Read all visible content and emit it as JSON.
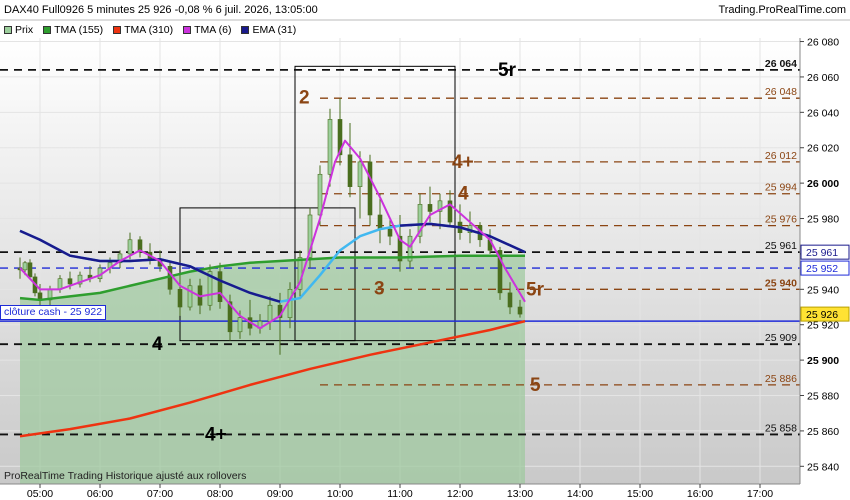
{
  "header": {
    "title": "DAX40 Full0926 5 minutes 25 926 -0,08 % 6 juil. 2026, 13:05:00",
    "site": "Trading.ProRealTime.com"
  },
  "legend": [
    {
      "label": "Prix",
      "color": "#9ccf9c"
    },
    {
      "label": "TMA (155)",
      "color": "#2e9e2e"
    },
    {
      "label": "TMA (310)",
      "color": "#ee3311"
    },
    {
      "label": "TMA (6)",
      "color": "#cc33dd"
    },
    {
      "label": "EMA (31)",
      "color": "#1a1a8c"
    }
  ],
  "cash_label": "clôture cash -  25 922",
  "caption": "ProRealTime Trading  Historique ajusté aux rollovers",
  "colors": {
    "grid": "#e4e4e4",
    "level_black": "#111111",
    "level_brown": "#8b4513",
    "cash_line": "#1f2bd8",
    "candles": "#4a6e1f",
    "area_fill": "#9cc99c",
    "tma6": "#cc33dd",
    "ema31": "#1a1a8c",
    "ema31_light": "#41b8f0",
    "tma155": "#2e9e2e",
    "tma310": "#ee3311",
    "last_price_bg": "#ffe233"
  },
  "chart_data": {
    "type": "line",
    "ylim": [
      25830,
      26082
    ],
    "x_ticks": [
      "05:00",
      "06:00",
      "07:00",
      "08:00",
      "09:00",
      "10:00",
      "11:00",
      "12:00",
      "13:00",
      "14:00",
      "15:00",
      "16:00",
      "17:00"
    ],
    "y_ticks": [
      25840,
      25860,
      25880,
      25900,
      25920,
      25940,
      25960,
      25980,
      26000,
      26020,
      26040,
      26060,
      26080
    ],
    "y_tick_labels": [
      "25 840",
      "25 860",
      "25 880",
      "25 900",
      "25 920",
      "25 940",
      "25 960",
      "25 980",
      "26 000",
      "26 020",
      "26 040",
      "26 060",
      "26 080"
    ],
    "last_price": {
      "value": 25926,
      "label": "25 926"
    },
    "series_end_labels": [
      {
        "value": 25961,
        "label": "25 961",
        "color": "#1a1a8c"
      },
      {
        "value": 25952,
        "label": "25 952",
        "color": "#1f2bd8"
      }
    ],
    "levels": [
      {
        "value": 26064,
        "label": "26 064",
        "tag": "5r",
        "color": "black",
        "bold": true
      },
      {
        "value": 26048,
        "label": "26 048",
        "tag": "",
        "color": "brown",
        "bold": false
      },
      {
        "value": 26012,
        "label": "26 012",
        "tag": "4+",
        "color": "brown",
        "bold": false
      },
      {
        "value": 25994,
        "label": "25 994",
        "tag": "4",
        "color": "brown",
        "bold": false
      },
      {
        "value": 25976,
        "label": "25 976",
        "tag": "",
        "color": "brown",
        "bold": false
      },
      {
        "value": 25961,
        "label": "25 961",
        "tag": "",
        "color": "black",
        "bold": false
      },
      {
        "value": 25952,
        "label": "",
        "tag": "",
        "color": "blue",
        "bold": false
      },
      {
        "value": 25940,
        "label": "25 940",
        "tag": "5r",
        "color": "brown",
        "bold": true
      },
      {
        "value": 25909,
        "label": "25 909",
        "tag": "4",
        "color": "black",
        "bold": false
      },
      {
        "value": 25886,
        "label": "25 886",
        "tag": "5",
        "color": "brown",
        "bold": false
      },
      {
        "value": 25858,
        "label": "25 858",
        "tag": "4+",
        "color": "black",
        "bold": false
      }
    ],
    "cash_close": 25922,
    "annotations": [
      {
        "text": "2",
        "x": "09:25",
        "y": 26045,
        "color": "brown"
      },
      {
        "text": "3",
        "x": "10:40",
        "y": 25937,
        "color": "brown"
      }
    ],
    "boxes": [
      {
        "x0": "07:20",
        "x1": "10:15",
        "y0": 25911,
        "y1": 25986
      },
      {
        "x0": "09:15",
        "x1": "11:55",
        "y0": 25911,
        "y1": 26066
      }
    ],
    "candles": [
      {
        "t": "04:40",
        "o": 25952,
        "h": 25958,
        "l": 25946,
        "c": 25951
      },
      {
        "t": "04:45",
        "o": 25951,
        "h": 25956,
        "l": 25948,
        "c": 25955
      },
      {
        "t": "04:50",
        "o": 25955,
        "h": 25957,
        "l": 25946,
        "c": 25947
      },
      {
        "t": "04:55",
        "o": 25947,
        "h": 25949,
        "l": 25936,
        "c": 25938
      },
      {
        "t": "05:00",
        "o": 25938,
        "h": 25943,
        "l": 25930,
        "c": 25934
      },
      {
        "t": "05:10",
        "o": 25934,
        "h": 25942,
        "l": 25931,
        "c": 25940
      },
      {
        "t": "05:20",
        "o": 25940,
        "h": 25948,
        "l": 25938,
        "c": 25946
      },
      {
        "t": "05:30",
        "o": 25946,
        "h": 25950,
        "l": 25940,
        "c": 25943
      },
      {
        "t": "05:40",
        "o": 25943,
        "h": 25950,
        "l": 25941,
        "c": 25948
      },
      {
        "t": "05:50",
        "o": 25948,
        "h": 25953,
        "l": 25944,
        "c": 25946
      },
      {
        "t": "06:00",
        "o": 25946,
        "h": 25954,
        "l": 25944,
        "c": 25952
      },
      {
        "t": "06:10",
        "o": 25952,
        "h": 25958,
        "l": 25949,
        "c": 25955
      },
      {
        "t": "06:20",
        "o": 25955,
        "h": 25962,
        "l": 25952,
        "c": 25960
      },
      {
        "t": "06:30",
        "o": 25960,
        "h": 25972,
        "l": 25957,
        "c": 25968
      },
      {
        "t": "06:40",
        "o": 25968,
        "h": 25970,
        "l": 25958,
        "c": 25961
      },
      {
        "t": "06:50",
        "o": 25961,
        "h": 25966,
        "l": 25954,
        "c": 25957
      },
      {
        "t": "07:00",
        "o": 25957,
        "h": 25962,
        "l": 25950,
        "c": 25953
      },
      {
        "t": "07:10",
        "o": 25953,
        "h": 25956,
        "l": 25937,
        "c": 25940
      },
      {
        "t": "07:20",
        "o": 25940,
        "h": 25948,
        "l": 25925,
        "c": 25930
      },
      {
        "t": "07:30",
        "o": 25930,
        "h": 25946,
        "l": 25928,
        "c": 25942
      },
      {
        "t": "07:40",
        "o": 25942,
        "h": 25946,
        "l": 25926,
        "c": 25931
      },
      {
        "t": "07:50",
        "o": 25931,
        "h": 25954,
        "l": 25928,
        "c": 25950
      },
      {
        "t": "08:00",
        "o": 25950,
        "h": 25955,
        "l": 25929,
        "c": 25933
      },
      {
        "t": "08:10",
        "o": 25933,
        "h": 25937,
        "l": 25911,
        "c": 25916
      },
      {
        "t": "08:20",
        "o": 25916,
        "h": 25928,
        "l": 25912,
        "c": 25924
      },
      {
        "t": "08:30",
        "o": 25924,
        "h": 25934,
        "l": 25914,
        "c": 25918
      },
      {
        "t": "08:40",
        "o": 25918,
        "h": 25926,
        "l": 25915,
        "c": 25922
      },
      {
        "t": "08:50",
        "o": 25922,
        "h": 25936,
        "l": 25917,
        "c": 25931
      },
      {
        "t": "09:00",
        "o": 25931,
        "h": 25938,
        "l": 25903,
        "c": 25924
      },
      {
        "t": "09:10",
        "o": 25924,
        "h": 25944,
        "l": 25918,
        "c": 25940
      },
      {
        "t": "09:20",
        "o": 25940,
        "h": 25962,
        "l": 25936,
        "c": 25958
      },
      {
        "t": "09:30",
        "o": 25958,
        "h": 25986,
        "l": 25952,
        "c": 25982
      },
      {
        "t": "09:40",
        "o": 25982,
        "h": 26010,
        "l": 25976,
        "c": 26005
      },
      {
        "t": "09:50",
        "o": 26005,
        "h": 26042,
        "l": 25998,
        "c": 26036
      },
      {
        "t": "10:00",
        "o": 26036,
        "h": 26048,
        "l": 26010,
        "c": 26016
      },
      {
        "t": "10:10",
        "o": 26016,
        "h": 26034,
        "l": 25992,
        "c": 25998
      },
      {
        "t": "10:20",
        "o": 25998,
        "h": 26018,
        "l": 25980,
        "c": 26012
      },
      {
        "t": "10:30",
        "o": 26012,
        "h": 26016,
        "l": 25976,
        "c": 25982
      },
      {
        "t": "10:40",
        "o": 25982,
        "h": 25994,
        "l": 25966,
        "c": 25974
      },
      {
        "t": "10:50",
        "o": 25974,
        "h": 25980,
        "l": 25965,
        "c": 25970
      },
      {
        "t": "11:00",
        "o": 25970,
        "h": 25982,
        "l": 25950,
        "c": 25956
      },
      {
        "t": "11:10",
        "o": 25956,
        "h": 25974,
        "l": 25952,
        "c": 25970
      },
      {
        "t": "11:20",
        "o": 25970,
        "h": 25994,
        "l": 25966,
        "c": 25988
      },
      {
        "t": "11:30",
        "o": 25988,
        "h": 25998,
        "l": 25978,
        "c": 25984
      },
      {
        "t": "11:40",
        "o": 25984,
        "h": 25994,
        "l": 25974,
        "c": 25990
      },
      {
        "t": "11:50",
        "o": 25990,
        "h": 25996,
        "l": 25976,
        "c": 25978
      },
      {
        "t": "12:00",
        "o": 25978,
        "h": 25988,
        "l": 25968,
        "c": 25972
      },
      {
        "t": "12:10",
        "o": 25972,
        "h": 25984,
        "l": 25966,
        "c": 25976
      },
      {
        "t": "12:20",
        "o": 25976,
        "h": 25978,
        "l": 25964,
        "c": 25968
      },
      {
        "t": "12:30",
        "o": 25968,
        "h": 25974,
        "l": 25960,
        "c": 25962
      },
      {
        "t": "12:40",
        "o": 25962,
        "h": 25964,
        "l": 25934,
        "c": 25938
      },
      {
        "t": "12:50",
        "o": 25938,
        "h": 25944,
        "l": 25926,
        "c": 25930
      },
      {
        "t": "13:00",
        "o": 25930,
        "h": 25934,
        "l": 25924,
        "c": 25926
      }
    ],
    "series": [
      {
        "name": "TMA (6)",
        "points": [
          [
            "04:40",
            25952
          ],
          [
            "05:00",
            25940
          ],
          [
            "05:20",
            25940
          ],
          [
            "05:40",
            25944
          ],
          [
            "06:00",
            25948
          ],
          [
            "06:20",
            25956
          ],
          [
            "06:40",
            25962
          ],
          [
            "07:00",
            25956
          ],
          [
            "07:20",
            25942
          ],
          [
            "07:40",
            25936
          ],
          [
            "08:00",
            25938
          ],
          [
            "08:20",
            25925
          ],
          [
            "08:40",
            25918
          ],
          [
            "09:00",
            25925
          ],
          [
            "09:20",
            25944
          ],
          [
            "09:40",
            25980
          ],
          [
            "09:55",
            26012
          ],
          [
            "10:05",
            26024
          ],
          [
            "10:20",
            26014
          ],
          [
            "10:40",
            25992
          ],
          [
            "11:00",
            25968
          ],
          [
            "11:10",
            25964
          ],
          [
            "11:30",
            25982
          ],
          [
            "11:50",
            25988
          ],
          [
            "12:10",
            25978
          ],
          [
            "12:30",
            25968
          ],
          [
            "12:45",
            25952
          ],
          [
            "13:05",
            25933
          ]
        ]
      },
      {
        "name": "EMA (31)",
        "points": [
          [
            "04:40",
            25973
          ],
          [
            "05:00",
            25968
          ],
          [
            "05:30",
            25959
          ],
          [
            "06:00",
            25956
          ],
          [
            "06:30",
            25956
          ],
          [
            "07:00",
            25957
          ],
          [
            "07:30",
            25953
          ],
          [
            "08:00",
            25945
          ],
          [
            "08:30",
            25938
          ],
          [
            "09:00",
            25933
          ],
          [
            "09:20",
            25935
          ],
          [
            "09:40",
            25948
          ],
          [
            "10:00",
            25962
          ],
          [
            "10:20",
            25970
          ],
          [
            "10:40",
            25974
          ],
          [
            "11:00",
            25976
          ],
          [
            "11:30",
            25977
          ],
          [
            "12:00",
            25975
          ],
          [
            "12:30",
            25970
          ],
          [
            "13:05",
            25961
          ]
        ]
      },
      {
        "name": "TMA (155)",
        "points": [
          [
            "04:40",
            25935
          ],
          [
            "05:00",
            25934
          ],
          [
            "05:30",
            25936
          ],
          [
            "06:00",
            25938
          ],
          [
            "06:30",
            25942
          ],
          [
            "07:00",
            25946
          ],
          [
            "07:30",
            25950
          ],
          [
            "08:00",
            25953
          ],
          [
            "08:30",
            25955
          ],
          [
            "09:00",
            25956
          ],
          [
            "09:30",
            25957
          ],
          [
            "10:00",
            25958
          ],
          [
            "11:00",
            25958
          ],
          [
            "12:00",
            25959
          ],
          [
            "13:05",
            25959
          ]
        ]
      },
      {
        "name": "TMA (310)",
        "points": [
          [
            "04:40",
            25857
          ],
          [
            "05:30",
            25861
          ],
          [
            "06:30",
            25867
          ],
          [
            "07:30",
            25876
          ],
          [
            "08:30",
            25886
          ],
          [
            "09:30",
            25895
          ],
          [
            "10:30",
            25903
          ],
          [
            "11:30",
            25910
          ],
          [
            "12:30",
            25917
          ],
          [
            "13:05",
            25922
          ]
        ]
      }
    ]
  }
}
